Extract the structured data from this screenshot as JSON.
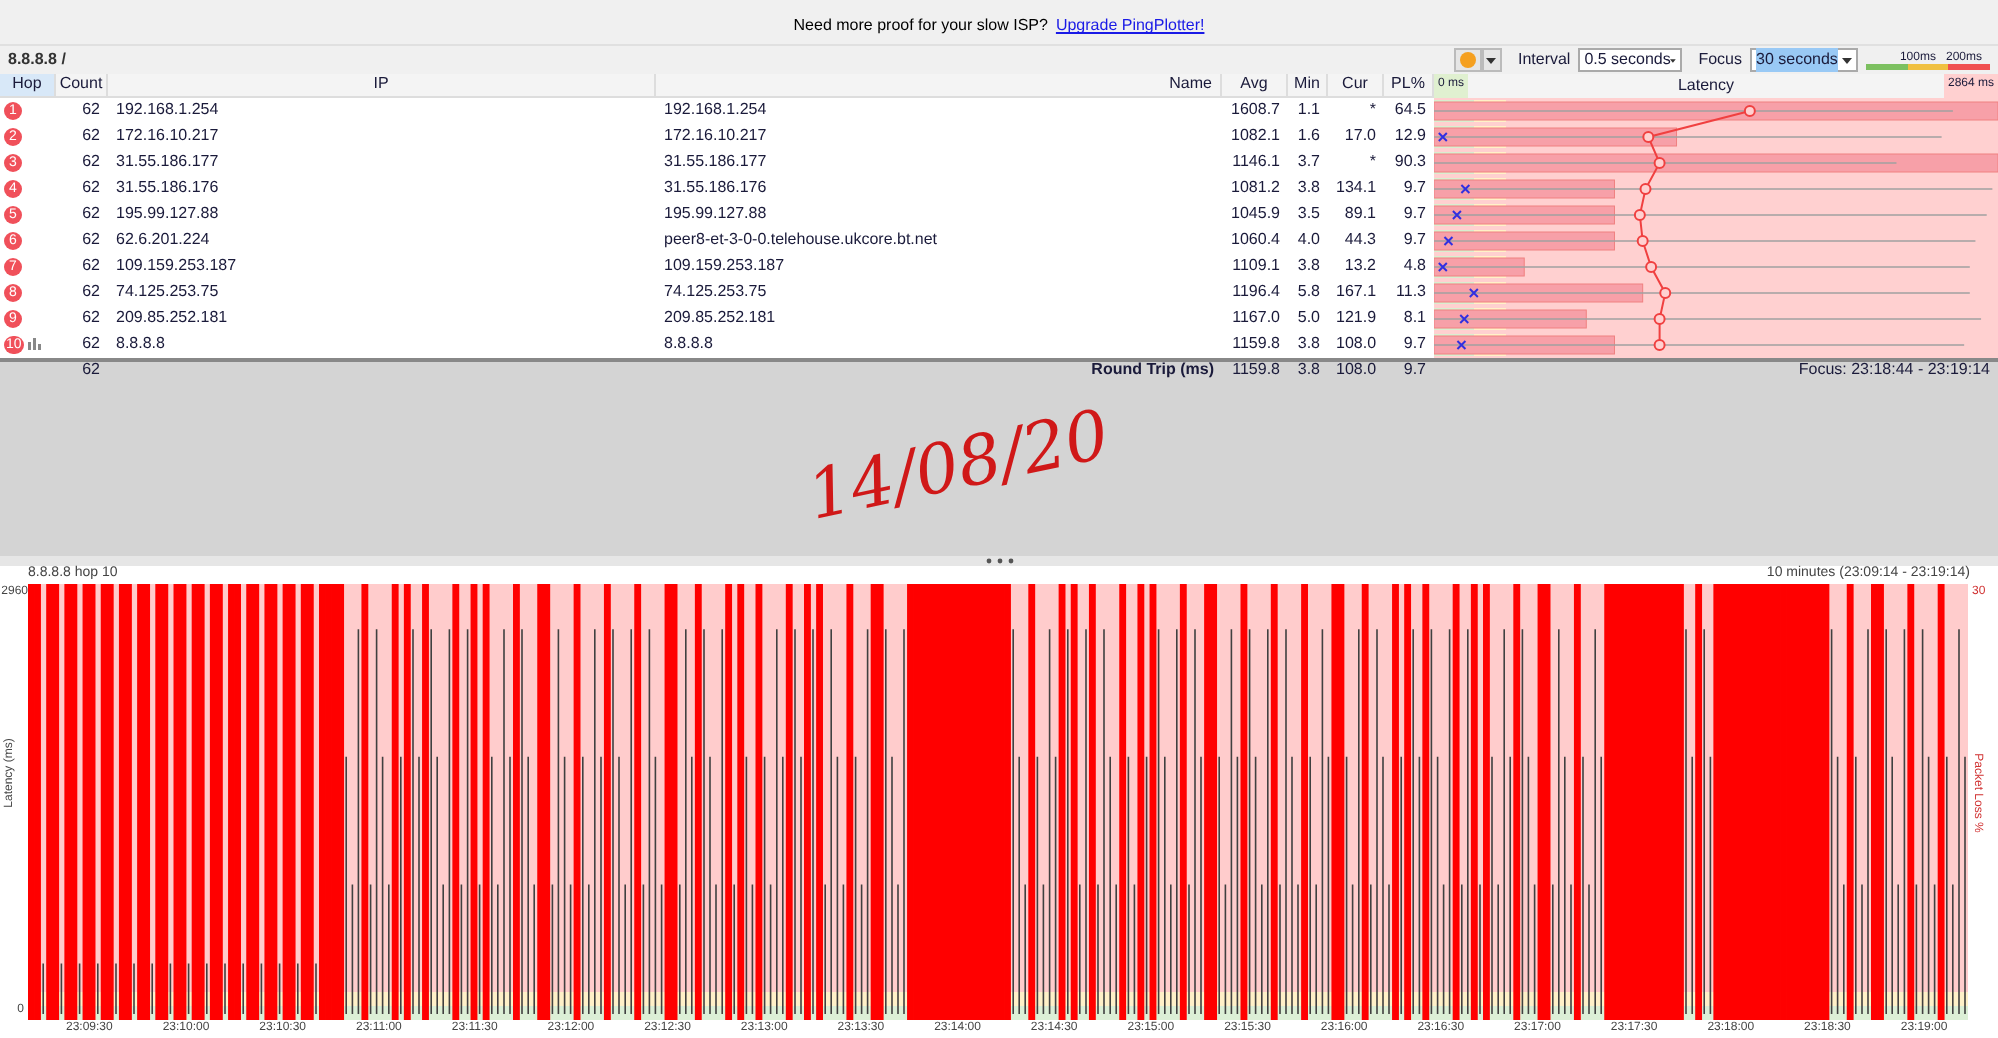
{
  "banner": {
    "text": "Need more proof for your slow ISP?",
    "link": "Upgrade PingPlotter!"
  },
  "toolbar": {
    "target": "8.8.8.8 /",
    "interval_label": "Interval",
    "interval_value": "0.5 seconds",
    "focus_label": "Focus",
    "focus_value": "30 seconds",
    "legend": [
      "100ms",
      "200ms"
    ]
  },
  "table": {
    "columns": [
      "Hop",
      "Count",
      "IP",
      "Name",
      "Avg",
      "Min",
      "Cur",
      "PL%"
    ],
    "latency_header": {
      "min": "0 ms",
      "title": "Latency",
      "max": "2864 ms"
    },
    "rows": [
      {
        "hop": "1",
        "count": "62",
        "ip": "192.168.1.254",
        "name": "192.168.1.254",
        "avg": "1608.7",
        "min": "1.1",
        "cur": "*",
        "pl": "64.5",
        "graphed": false
      },
      {
        "hop": "2",
        "count": "62",
        "ip": "172.16.10.217",
        "name": "172.16.10.217",
        "avg": "1082.1",
        "min": "1.6",
        "cur": "17.0",
        "pl": "12.9",
        "graphed": false
      },
      {
        "hop": "3",
        "count": "62",
        "ip": "31.55.186.177",
        "name": "31.55.186.177",
        "avg": "1146.1",
        "min": "3.7",
        "cur": "*",
        "pl": "90.3",
        "graphed": false
      },
      {
        "hop": "4",
        "count": "62",
        "ip": "31.55.186.176",
        "name": "31.55.186.176",
        "avg": "1081.2",
        "min": "3.8",
        "cur": "134.1",
        "pl": "9.7",
        "graphed": false
      },
      {
        "hop": "5",
        "count": "62",
        "ip": "195.99.127.88",
        "name": "195.99.127.88",
        "avg": "1045.9",
        "min": "3.5",
        "cur": "89.1",
        "pl": "9.7",
        "graphed": false
      },
      {
        "hop": "6",
        "count": "62",
        "ip": "62.6.201.224",
        "name": "peer8-et-3-0-0.telehouse.ukcore.bt.net",
        "avg": "1060.4",
        "min": "4.0",
        "cur": "44.3",
        "pl": "9.7",
        "graphed": false
      },
      {
        "hop": "7",
        "count": "62",
        "ip": "109.159.253.187",
        "name": "109.159.253.187",
        "avg": "1109.1",
        "min": "3.8",
        "cur": "13.2",
        "pl": "4.8",
        "graphed": false
      },
      {
        "hop": "8",
        "count": "62",
        "ip": "74.125.253.75",
        "name": "74.125.253.75",
        "avg": "1196.4",
        "min": "5.8",
        "cur": "167.1",
        "pl": "11.3",
        "graphed": false
      },
      {
        "hop": "9",
        "count": "62",
        "ip": "209.85.252.181",
        "name": "209.85.252.181",
        "avg": "1167.0",
        "min": "5.0",
        "cur": "121.9",
        "pl": "8.1",
        "graphed": false
      },
      {
        "hop": "10",
        "count": "62",
        "ip": "8.8.8.8",
        "name": "8.8.8.8",
        "avg": "1159.8",
        "min": "3.8",
        "cur": "108.0",
        "pl": "9.7",
        "graphed": true
      }
    ],
    "summary": {
      "count": "62",
      "label": "Round Trip (ms)",
      "avg": "1159.8",
      "min": "3.8",
      "cur": "108.0",
      "pl": "9.7",
      "focus": "Focus: 23:18:44 - 23:19:14"
    }
  },
  "handwriting": "14/08/20",
  "history": {
    "title": "8.8.8.8 hop 10",
    "range": "10 minutes (23:09:14 - 23:19:14)",
    "y_max": "2960",
    "y_min": "0",
    "y_label": "Latency (ms)",
    "right_max": "30",
    "right_label": "Packet Loss %",
    "times": [
      "23:09:30",
      "23:10:00",
      "23:10:30",
      "23:11:00",
      "23:11:30",
      "23:12:00",
      "23:12:30",
      "23:13:00",
      "23:13:30",
      "23:14:00",
      "23:14:30",
      "23:15:00",
      "23:15:30",
      "23:16:00",
      "23:16:30",
      "23:17:00",
      "23:17:30",
      "23:18:00",
      "23:18:30",
      "23:19:00"
    ]
  }
}
